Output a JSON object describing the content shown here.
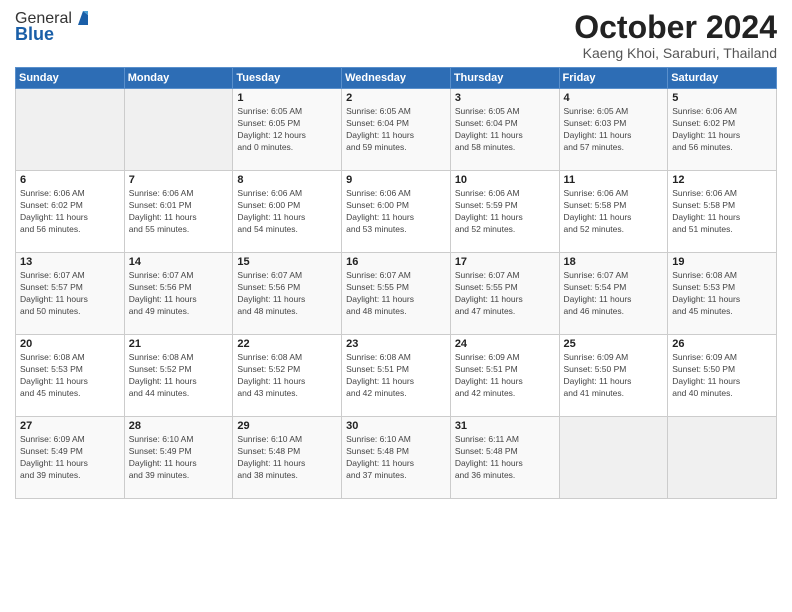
{
  "header": {
    "logo_general": "General",
    "logo_blue": "Blue",
    "title": "October 2024",
    "subtitle": "Kaeng Khoi, Saraburi, Thailand"
  },
  "weekdays": [
    "Sunday",
    "Monday",
    "Tuesday",
    "Wednesday",
    "Thursday",
    "Friday",
    "Saturday"
  ],
  "weeks": [
    [
      {
        "day": "",
        "info": ""
      },
      {
        "day": "",
        "info": ""
      },
      {
        "day": "1",
        "info": "Sunrise: 6:05 AM\nSunset: 6:05 PM\nDaylight: 12 hours\nand 0 minutes."
      },
      {
        "day": "2",
        "info": "Sunrise: 6:05 AM\nSunset: 6:04 PM\nDaylight: 11 hours\nand 59 minutes."
      },
      {
        "day": "3",
        "info": "Sunrise: 6:05 AM\nSunset: 6:04 PM\nDaylight: 11 hours\nand 58 minutes."
      },
      {
        "day": "4",
        "info": "Sunrise: 6:05 AM\nSunset: 6:03 PM\nDaylight: 11 hours\nand 57 minutes."
      },
      {
        "day": "5",
        "info": "Sunrise: 6:06 AM\nSunset: 6:02 PM\nDaylight: 11 hours\nand 56 minutes."
      }
    ],
    [
      {
        "day": "6",
        "info": "Sunrise: 6:06 AM\nSunset: 6:02 PM\nDaylight: 11 hours\nand 56 minutes."
      },
      {
        "day": "7",
        "info": "Sunrise: 6:06 AM\nSunset: 6:01 PM\nDaylight: 11 hours\nand 55 minutes."
      },
      {
        "day": "8",
        "info": "Sunrise: 6:06 AM\nSunset: 6:00 PM\nDaylight: 11 hours\nand 54 minutes."
      },
      {
        "day": "9",
        "info": "Sunrise: 6:06 AM\nSunset: 6:00 PM\nDaylight: 11 hours\nand 53 minutes."
      },
      {
        "day": "10",
        "info": "Sunrise: 6:06 AM\nSunset: 5:59 PM\nDaylight: 11 hours\nand 52 minutes."
      },
      {
        "day": "11",
        "info": "Sunrise: 6:06 AM\nSunset: 5:58 PM\nDaylight: 11 hours\nand 52 minutes."
      },
      {
        "day": "12",
        "info": "Sunrise: 6:06 AM\nSunset: 5:58 PM\nDaylight: 11 hours\nand 51 minutes."
      }
    ],
    [
      {
        "day": "13",
        "info": "Sunrise: 6:07 AM\nSunset: 5:57 PM\nDaylight: 11 hours\nand 50 minutes."
      },
      {
        "day": "14",
        "info": "Sunrise: 6:07 AM\nSunset: 5:56 PM\nDaylight: 11 hours\nand 49 minutes."
      },
      {
        "day": "15",
        "info": "Sunrise: 6:07 AM\nSunset: 5:56 PM\nDaylight: 11 hours\nand 48 minutes."
      },
      {
        "day": "16",
        "info": "Sunrise: 6:07 AM\nSunset: 5:55 PM\nDaylight: 11 hours\nand 48 minutes."
      },
      {
        "day": "17",
        "info": "Sunrise: 6:07 AM\nSunset: 5:55 PM\nDaylight: 11 hours\nand 47 minutes."
      },
      {
        "day": "18",
        "info": "Sunrise: 6:07 AM\nSunset: 5:54 PM\nDaylight: 11 hours\nand 46 minutes."
      },
      {
        "day": "19",
        "info": "Sunrise: 6:08 AM\nSunset: 5:53 PM\nDaylight: 11 hours\nand 45 minutes."
      }
    ],
    [
      {
        "day": "20",
        "info": "Sunrise: 6:08 AM\nSunset: 5:53 PM\nDaylight: 11 hours\nand 45 minutes."
      },
      {
        "day": "21",
        "info": "Sunrise: 6:08 AM\nSunset: 5:52 PM\nDaylight: 11 hours\nand 44 minutes."
      },
      {
        "day": "22",
        "info": "Sunrise: 6:08 AM\nSunset: 5:52 PM\nDaylight: 11 hours\nand 43 minutes."
      },
      {
        "day": "23",
        "info": "Sunrise: 6:08 AM\nSunset: 5:51 PM\nDaylight: 11 hours\nand 42 minutes."
      },
      {
        "day": "24",
        "info": "Sunrise: 6:09 AM\nSunset: 5:51 PM\nDaylight: 11 hours\nand 42 minutes."
      },
      {
        "day": "25",
        "info": "Sunrise: 6:09 AM\nSunset: 5:50 PM\nDaylight: 11 hours\nand 41 minutes."
      },
      {
        "day": "26",
        "info": "Sunrise: 6:09 AM\nSunset: 5:50 PM\nDaylight: 11 hours\nand 40 minutes."
      }
    ],
    [
      {
        "day": "27",
        "info": "Sunrise: 6:09 AM\nSunset: 5:49 PM\nDaylight: 11 hours\nand 39 minutes."
      },
      {
        "day": "28",
        "info": "Sunrise: 6:10 AM\nSunset: 5:49 PM\nDaylight: 11 hours\nand 39 minutes."
      },
      {
        "day": "29",
        "info": "Sunrise: 6:10 AM\nSunset: 5:48 PM\nDaylight: 11 hours\nand 38 minutes."
      },
      {
        "day": "30",
        "info": "Sunrise: 6:10 AM\nSunset: 5:48 PM\nDaylight: 11 hours\nand 37 minutes."
      },
      {
        "day": "31",
        "info": "Sunrise: 6:11 AM\nSunset: 5:48 PM\nDaylight: 11 hours\nand 36 minutes."
      },
      {
        "day": "",
        "info": ""
      },
      {
        "day": "",
        "info": ""
      }
    ]
  ]
}
